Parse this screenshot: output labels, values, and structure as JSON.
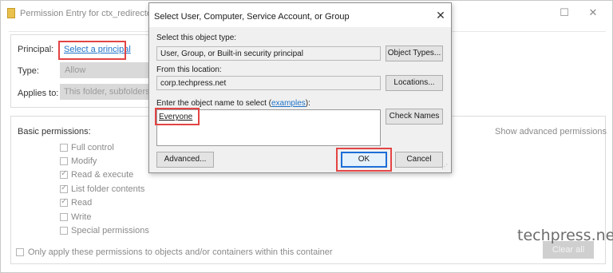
{
  "bg_window": {
    "title": "Permission Entry for ctx_redirectedfo",
    "maximize_glyph": "☐",
    "close_glyph": "✕",
    "principal_label": "Principal:",
    "principal_link": "Select a principal",
    "type_label": "Type:",
    "type_value": "Allow",
    "applies_label": "Applies to:",
    "applies_value": "This folder, subfolders a",
    "basic_permissions_label": "Basic permissions:",
    "show_advanced": "Show advanced permissions",
    "permissions": [
      {
        "label": "Full control",
        "checked": false
      },
      {
        "label": "Modify",
        "checked": false
      },
      {
        "label": "Read & execute",
        "checked": true
      },
      {
        "label": "List folder contents",
        "checked": true
      },
      {
        "label": "Read",
        "checked": true
      },
      {
        "label": "Write",
        "checked": false
      },
      {
        "label": "Special permissions",
        "checked": false
      }
    ],
    "only_apply_label": "Only apply these permissions to objects and/or containers within this container",
    "clear_all_label": "Clear all"
  },
  "watermark": "techpress.net",
  "dialog": {
    "title": "Select User, Computer, Service Account, or Group",
    "close_glyph": "✕",
    "object_type_label": "Select this object type:",
    "object_type_value": "User, Group, or Built-in security principal",
    "object_types_button": "Object Types...",
    "location_label": "From this location:",
    "location_value": "corp.techpress.net",
    "locations_button": "Locations...",
    "enter_name_prefix": "Enter the object name to select (",
    "examples_link": "examples",
    "enter_name_suffix": "):",
    "object_name_value": "Everyone",
    "check_names_button": "Check Names",
    "advanced_button": "Advanced...",
    "ok_button": "OK",
    "cancel_button": "Cancel"
  },
  "colors": {
    "highlight_red": "#e34444",
    "link_blue": "#1e73c8",
    "default_button_border": "#1c6fd6"
  }
}
